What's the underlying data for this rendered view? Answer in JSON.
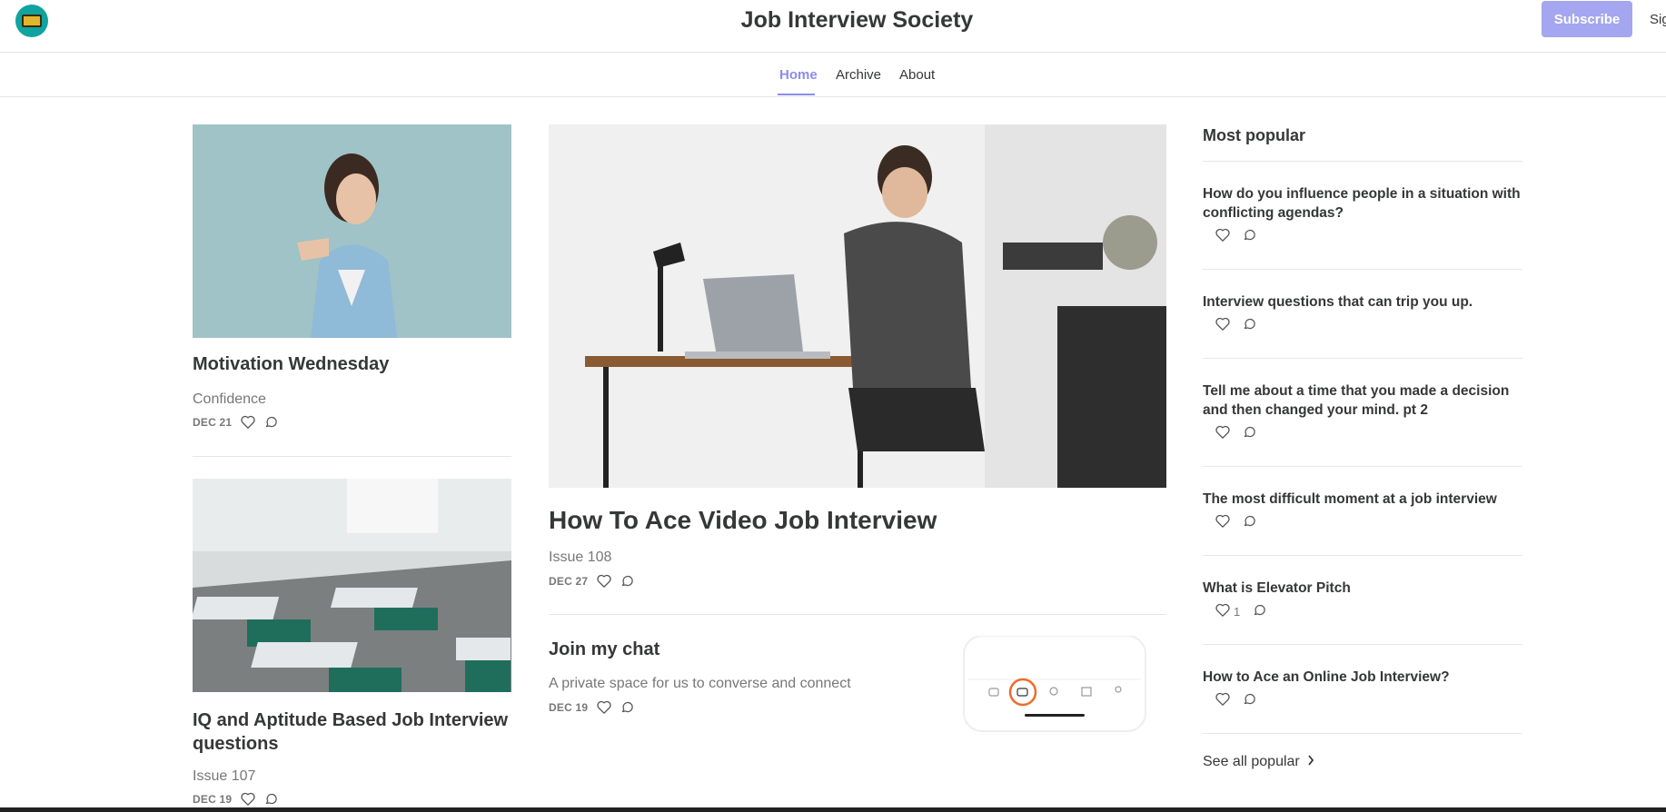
{
  "header": {
    "site_title": "Job Interview Society",
    "subscribe_label": "Subscribe",
    "signin_label": "Sig"
  },
  "nav": {
    "items": [
      {
        "label": "Home",
        "active": true
      },
      {
        "label": "Archive",
        "active": false
      },
      {
        "label": "About",
        "active": false
      }
    ]
  },
  "posts": {
    "motivation": {
      "title": "Motivation Wednesday",
      "subtitle": "Confidence",
      "date": "DEC 21"
    },
    "iq": {
      "title": "IQ and Aptitude Based Job Interview questions",
      "subtitle": "Issue 107",
      "date": "DEC 19"
    },
    "featured": {
      "title": "How To Ace Video Job Interview",
      "subtitle": "Issue 108",
      "date": "DEC 27"
    },
    "chat": {
      "title": "Join my chat",
      "subtitle": "A private space for us to converse and connect",
      "date": "DEC 19"
    }
  },
  "sidebar": {
    "title": "Most popular",
    "items": [
      {
        "title": "How do you influence people in a situation with conflicting agendas?",
        "likes": ""
      },
      {
        "title": "Interview questions that can trip you up.",
        "likes": ""
      },
      {
        "title": "Tell me about a time that you made a decision and then changed your mind. pt 2",
        "likes": ""
      },
      {
        "title": "The most difficult moment at a job interview",
        "likes": ""
      },
      {
        "title": "What is Elevator Pitch",
        "likes": "1"
      },
      {
        "title": "How to Ace an Online Job Interview?",
        "likes": ""
      }
    ],
    "see_all_label": "See all popular"
  },
  "colors": {
    "accent": "#8b8deb",
    "subscribe_bg": "#a4a6ef",
    "text": "#363737",
    "muted": "#777777"
  }
}
